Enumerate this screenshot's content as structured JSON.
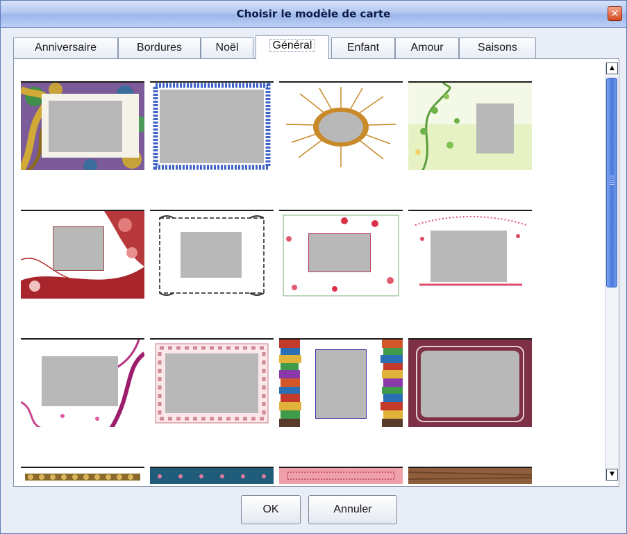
{
  "window": {
    "title": "Choisir le modèle de carte",
    "close_glyph": "✕"
  },
  "tabs": [
    {
      "label": "Anniversaire",
      "active": false
    },
    {
      "label": "Bordures",
      "active": false
    },
    {
      "label": "Noël",
      "active": false
    },
    {
      "label": "Général",
      "active": true
    },
    {
      "label": "Enfant",
      "active": false
    },
    {
      "label": "Amour",
      "active": false
    },
    {
      "label": "Saisons",
      "active": false
    }
  ],
  "templates": [
    {
      "name": "gold-purple-ornate-frame",
      "style": "ornate"
    },
    {
      "name": "blue-lace-border",
      "style": "blue"
    },
    {
      "name": "golden-sunburst-wreath",
      "style": "sunburst"
    },
    {
      "name": "green-vine-leaves",
      "style": "greenvine"
    },
    {
      "name": "red-floral-swirl",
      "style": "redfloral"
    },
    {
      "name": "black-scroll-border",
      "style": "blackscroll"
    },
    {
      "name": "pink-flower-garland",
      "style": "pinkgarland"
    },
    {
      "name": "red-dotted-flourish",
      "style": "reddots"
    },
    {
      "name": "magenta-branches",
      "style": "magenta"
    },
    {
      "name": "pink-tile-border",
      "style": "pinktile"
    },
    {
      "name": "stacked-books",
      "style": "books"
    },
    {
      "name": "burgundy-ornate-frame",
      "style": "burgundy"
    },
    {
      "name": "gold-beaded-border",
      "style": "beads"
    },
    {
      "name": "teal-pattern-border",
      "style": "teal"
    },
    {
      "name": "pink-striped-border",
      "style": "pinkstripe"
    },
    {
      "name": "wood-texture-frame",
      "style": "wood"
    }
  ],
  "scrollbar": {
    "up_glyph": "▲",
    "down_glyph": "▼",
    "position_fraction": 0.0
  },
  "buttons": {
    "ok_label": "OK",
    "cancel_label": "Annuler"
  },
  "colors": {
    "title_bar": "#b2c8f0",
    "scroll_thumb": "#4a79dc",
    "photo_placeholder": "#b8b8b8"
  }
}
